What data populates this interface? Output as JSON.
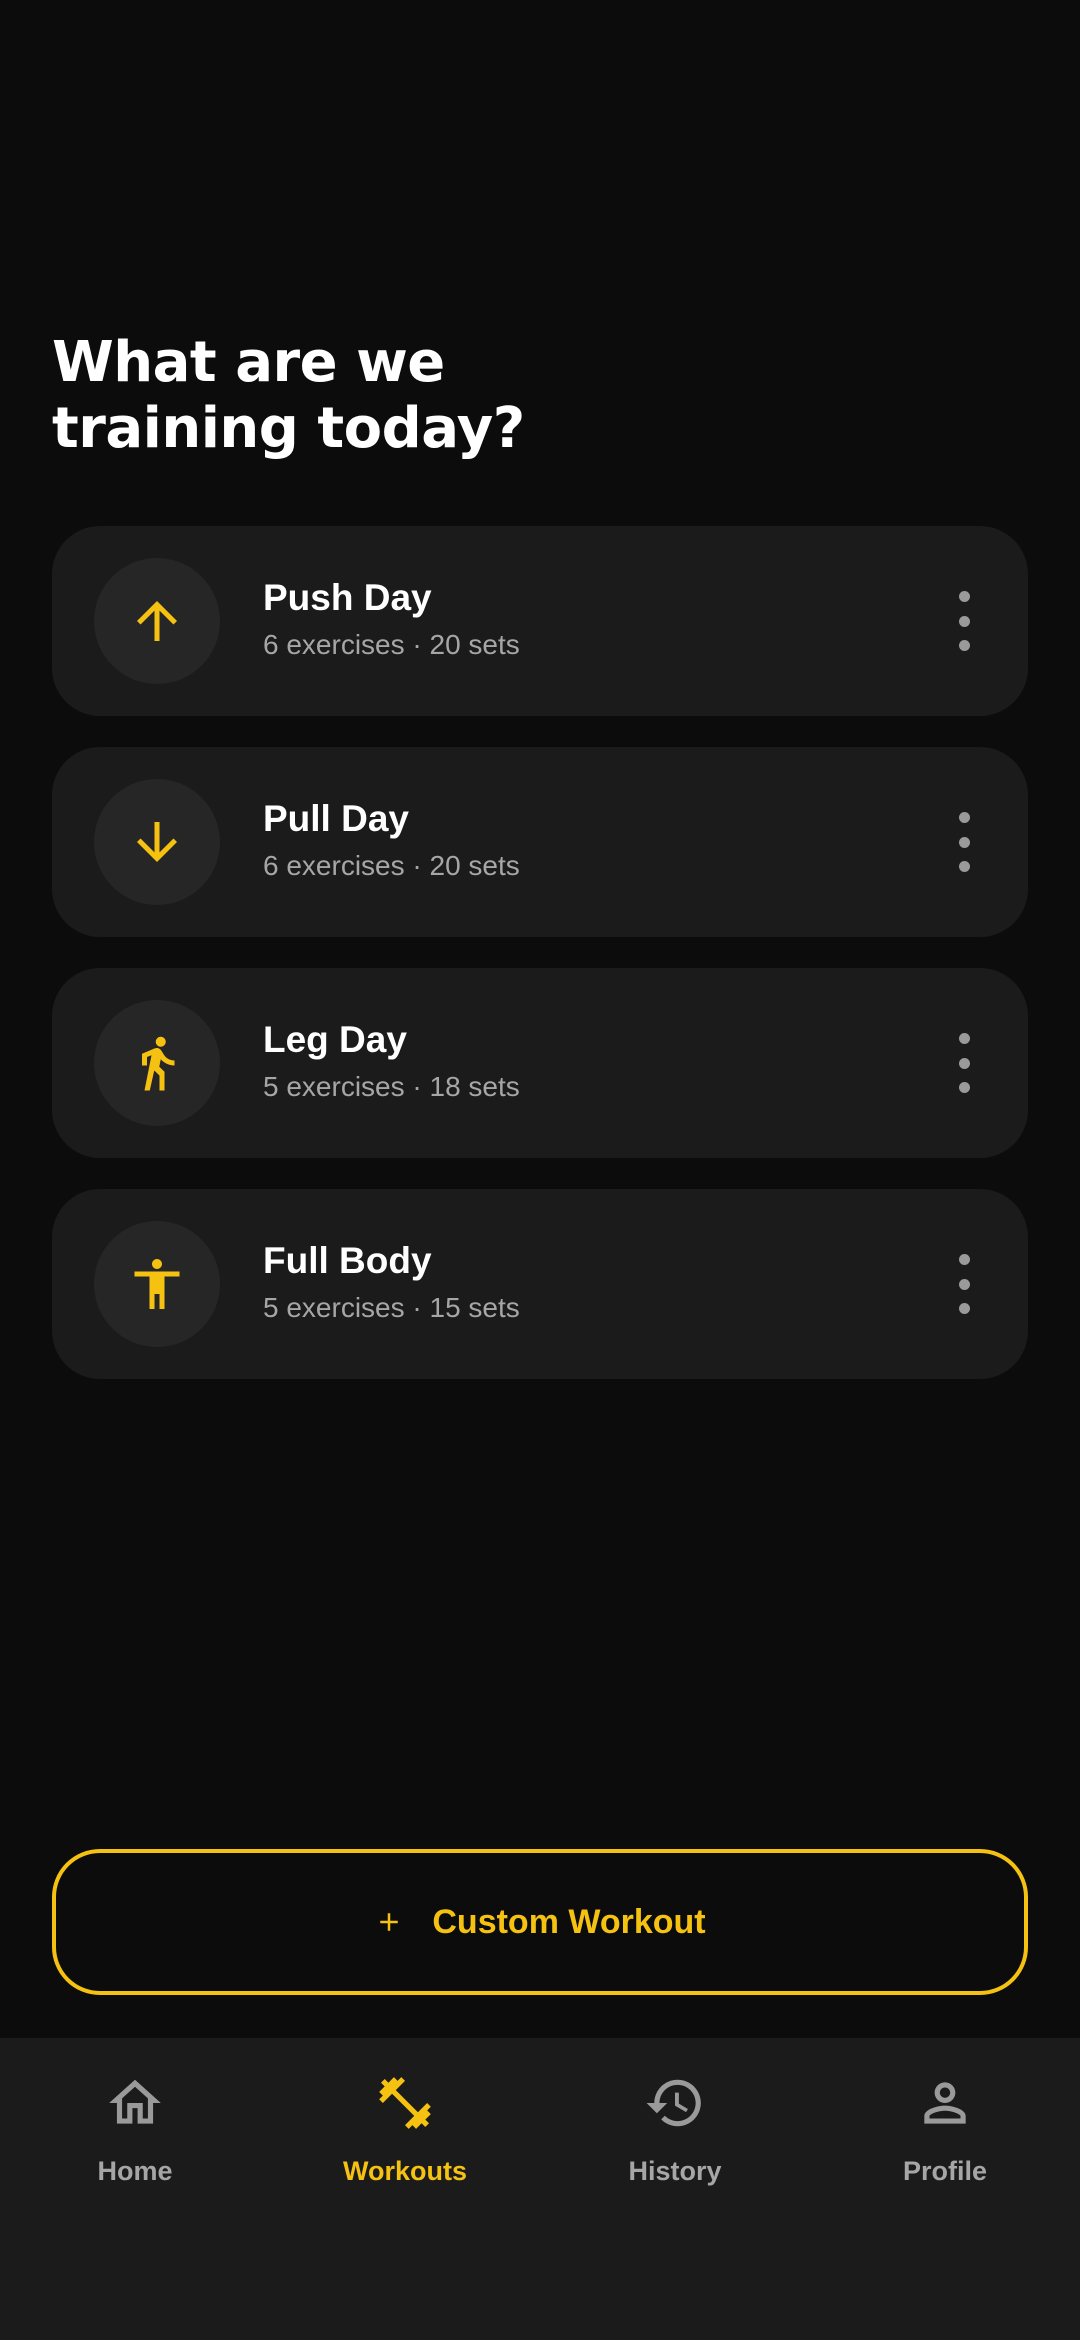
{
  "header": {
    "title_line1": "What are we",
    "title_line2": "training today?"
  },
  "workouts": [
    {
      "name": "Push Day",
      "meta": "6 exercises · 20 sets",
      "icon": "arrow-up-icon"
    },
    {
      "name": "Pull Day",
      "meta": "6 exercises · 20 sets",
      "icon": "arrow-down-icon"
    },
    {
      "name": "Leg Day",
      "meta": "5 exercises · 18 sets",
      "icon": "walking-person-icon"
    },
    {
      "name": "Full Body",
      "meta": "5 exercises · 15 sets",
      "icon": "person-arms-out-icon"
    }
  ],
  "custom_button": {
    "label": "Custom Workout",
    "icon": "plus-icon"
  },
  "nav": {
    "items": [
      {
        "label": "Home",
        "icon": "home-icon"
      },
      {
        "label": "Workouts",
        "icon": "dumbbell-icon"
      },
      {
        "label": "History",
        "icon": "history-icon"
      },
      {
        "label": "Profile",
        "icon": "person-icon"
      }
    ],
    "active": "Workouts"
  },
  "colors": {
    "background": "#0c0c0c",
    "card": "#1b1b1b",
    "accent": "#f5c211",
    "muted_text": "#a6a6a6"
  }
}
